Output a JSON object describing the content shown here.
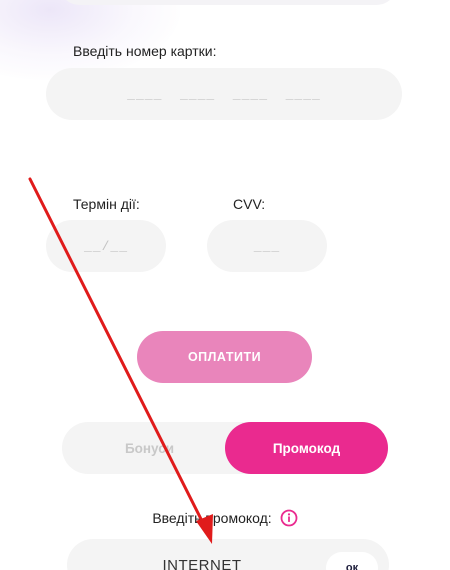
{
  "card_number": {
    "label": "Введіть номер картки:",
    "placeholder": "____  ____  ____  ____"
  },
  "expiry": {
    "label": "Термін дії:",
    "placeholder": "__/__"
  },
  "cvv": {
    "label": "CVV:",
    "placeholder": "___"
  },
  "pay_button_label": "ОПЛАТИТИ",
  "tabs": {
    "bonus_label": "Бонуси",
    "promo_label": "Промокод"
  },
  "promo": {
    "label": "Введіть промокод:",
    "value": "INTERNET",
    "ok_label": "ок"
  },
  "colors": {
    "brand_pink": "#ea2a8f",
    "pay_button": "#e985bb",
    "annotation_arrow": "#e01b1b"
  },
  "icons": {
    "info": "info-circle-icon",
    "annotation": "red-arrow"
  }
}
